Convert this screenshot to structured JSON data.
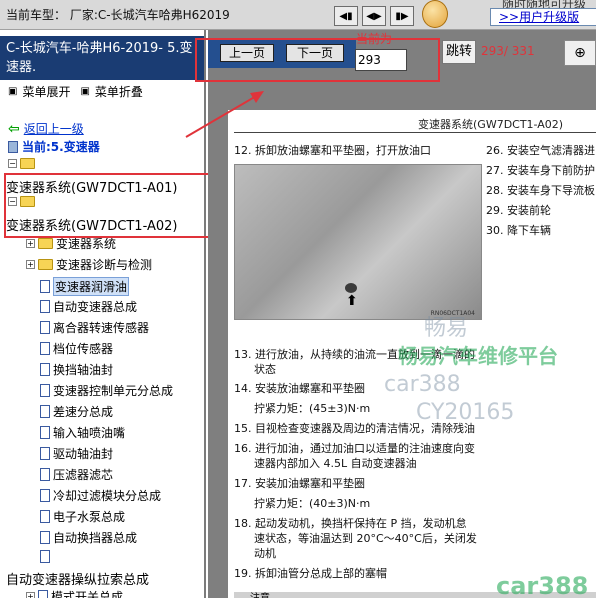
{
  "topbar": {
    "current_model_label": "当前车型：",
    "current_model_value": "厂家:C-长城汽车哈弗H62019",
    "nav_icons": [
      "first-page-icon",
      "fit-icon",
      "last-page-icon"
    ],
    "upgrade_top_text": "随时随地可升级",
    "upgrade_link": ">>用户升级版"
  },
  "sidebar": {
    "title": "C-长城汽车-哈弗H6-2019- 5.变速器.",
    "expand_label": "菜单展开",
    "collapse_label": "菜单折叠",
    "back_label": "返回上一级",
    "current_label": "当前:5.变速器",
    "tree": {
      "root_folder": "",
      "item_a01": "变速器系统(GW7DCT1-A01)",
      "item_a02": "变速器系统(GW7DCT1-A02)",
      "children": [
        "变速器系统",
        "变速器诊断与检测",
        "变速器润滑油",
        "自动变速器总成",
        "离合器转速传感器",
        "档位传感器",
        "换挡轴油封",
        "变速器控制单元分总成",
        "差速分总成",
        "输入轴喷油嘴",
        "驱动轴油封",
        "压滤器滤芯",
        "冷却过滤模块分总成",
        "电子水泵总成",
        "自动换挡器总成",
        ""
      ],
      "selected_index": 2,
      "bottom_item": "自动变速器操纵拉索总成",
      "bottom_child": "模式开关总成"
    }
  },
  "toolbar": {
    "prev_label": "上一页",
    "next_label": "下一页",
    "current_page_label": "当前为",
    "current_page_value": "293",
    "jump_label": "跳转",
    "page_count": "293/ 331",
    "zoom_icon": "zoom-in-icon"
  },
  "document": {
    "header": "变速器系统(GW7DCT1-A02)",
    "figure_code": "RN06DCT1A04",
    "left_steps": [
      "12. 拆卸放油螺塞和平垫圈，打开放油口",
      "13. 进行放油，从持续的油流一直放到一滴一滴的",
      "状态",
      "14. 安装放油螺塞和平垫圈",
      "拧紧力矩：(45±3)N·m",
      "15. 目视检查变速器及周边的清洁情况，清除残油",
      "16. 进行加油，通过加油口以适量的注油速度向变",
      "速器内部加入 4.5L 自动变速器油",
      "17. 安装加油螺塞和平垫圈",
      "拧紧力矩：(40±3)N·m",
      "18. 起动发动机，换挡杆保持在 P 挡，发动机怠",
      "速状态，等油温达到 20°C～40°C后，关闭发",
      "动机",
      "19. 拆卸油管分总成上部的塞帽"
    ],
    "right_steps": [
      "26. 安装空气滤清器进",
      "27. 安装车身下前防护",
      "28. 安装车身下导流板",
      "29. 安装前轮",
      "30. 降下车辆"
    ],
    "note_label": "注意",
    "watermarks": [
      "畅易",
      "畅易汽车维修平台",
      "car388",
      "CY20165",
      "car388"
    ]
  },
  "colors": {
    "sidebar_title_bg": "#1a3c73",
    "highlight_red": "#e0333a",
    "link_blue": "#0033cc",
    "nav_strip": "#244f8f"
  }
}
